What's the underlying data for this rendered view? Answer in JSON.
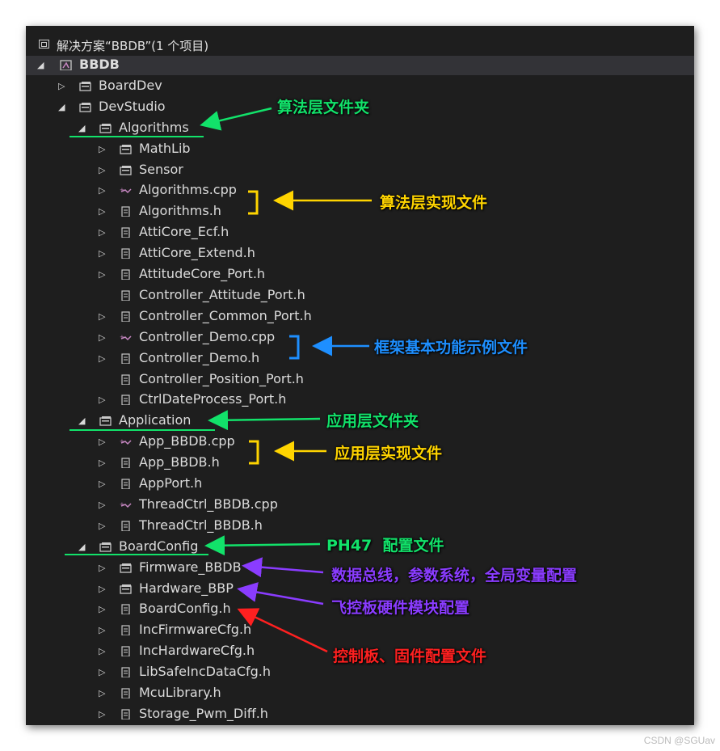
{
  "solution_header": "解决方案“BBDB”(1 个项目)",
  "tree": [
    {
      "id": "bbdb",
      "label": "BBDB",
      "depth": 0,
      "toggle": "expanded",
      "icon": "project-icon",
      "bold": true,
      "selected": true
    },
    {
      "id": "boarddev",
      "label": "BoardDev",
      "depth": 1,
      "toggle": "collapsed",
      "icon": "filter-folder-icon"
    },
    {
      "id": "devstudio",
      "label": "DevStudio",
      "depth": 1,
      "toggle": "expanded",
      "icon": "filter-folder-icon"
    },
    {
      "id": "algorithms",
      "label": "Algorithms",
      "depth": 2,
      "toggle": "expanded",
      "icon": "filter-folder-icon"
    },
    {
      "id": "mathlib",
      "label": "MathLib",
      "depth": 3,
      "toggle": "collapsed",
      "icon": "filter-folder-icon"
    },
    {
      "id": "sensor",
      "label": "Sensor",
      "depth": 3,
      "toggle": "collapsed",
      "icon": "filter-folder-icon"
    },
    {
      "id": "algorithms-cpp",
      "label": "Algorithms.cpp",
      "depth": 3,
      "toggle": "collapsed",
      "icon": "cpp-file-icon"
    },
    {
      "id": "algorithms-h",
      "label": "Algorithms.h",
      "depth": 3,
      "toggle": "collapsed",
      "icon": "header-file-icon"
    },
    {
      "id": "atticore-ecf",
      "label": "AttiCore_Ecf.h",
      "depth": 3,
      "toggle": "collapsed",
      "icon": "header-file-icon"
    },
    {
      "id": "atticore-extend",
      "label": "AttiCore_Extend.h",
      "depth": 3,
      "toggle": "collapsed",
      "icon": "header-file-icon"
    },
    {
      "id": "attitudecore-port",
      "label": "AttitudeCore_Port.h",
      "depth": 3,
      "toggle": "collapsed",
      "icon": "header-file-icon"
    },
    {
      "id": "controller-attitude-port",
      "label": "Controller_Attitude_Port.h",
      "depth": 3,
      "toggle": "none",
      "icon": "header-file-icon"
    },
    {
      "id": "controller-common-port",
      "label": "Controller_Common_Port.h",
      "depth": 3,
      "toggle": "collapsed",
      "icon": "header-file-icon"
    },
    {
      "id": "controller-demo-cpp",
      "label": "Controller_Demo.cpp",
      "depth": 3,
      "toggle": "collapsed",
      "icon": "cpp-file-icon"
    },
    {
      "id": "controller-demo-h",
      "label": "Controller_Demo.h",
      "depth": 3,
      "toggle": "collapsed",
      "icon": "header-file-icon"
    },
    {
      "id": "controller-position-port",
      "label": "Controller_Position_Port.h",
      "depth": 3,
      "toggle": "none",
      "icon": "header-file-icon"
    },
    {
      "id": "ctrldateprocess-port",
      "label": "CtrlDateProcess_Port.h",
      "depth": 3,
      "toggle": "collapsed",
      "icon": "header-file-icon"
    },
    {
      "id": "application",
      "label": "Application",
      "depth": 2,
      "toggle": "expanded",
      "icon": "filter-folder-icon"
    },
    {
      "id": "app-bbdb-cpp",
      "label": "App_BBDB.cpp",
      "depth": 3,
      "toggle": "collapsed",
      "icon": "cpp-file-icon"
    },
    {
      "id": "app-bbdb-h",
      "label": "App_BBDB.h",
      "depth": 3,
      "toggle": "collapsed",
      "icon": "header-file-icon"
    },
    {
      "id": "appport-h",
      "label": "AppPort.h",
      "depth": 3,
      "toggle": "collapsed",
      "icon": "header-file-icon"
    },
    {
      "id": "threadctrl-bbdb-cpp",
      "label": "ThreadCtrl_BBDB.cpp",
      "depth": 3,
      "toggle": "collapsed",
      "icon": "cpp-file-icon"
    },
    {
      "id": "threadctrl-bbdb-h",
      "label": "ThreadCtrl_BBDB.h",
      "depth": 3,
      "toggle": "collapsed",
      "icon": "header-file-icon"
    },
    {
      "id": "boardconfig",
      "label": "BoardConfig",
      "depth": 2,
      "toggle": "expanded",
      "icon": "filter-folder-icon"
    },
    {
      "id": "firmware-bbdb",
      "label": "Firmware_BBDB",
      "depth": 3,
      "toggle": "collapsed",
      "icon": "filter-folder-icon"
    },
    {
      "id": "hardware-bbp",
      "label": "Hardware_BBP",
      "depth": 3,
      "toggle": "collapsed",
      "icon": "filter-folder-icon"
    },
    {
      "id": "boardconfig-h",
      "label": "BoardConfig.h",
      "depth": 3,
      "toggle": "collapsed",
      "icon": "header-file-icon"
    },
    {
      "id": "incfirmwarecfg-h",
      "label": "IncFirmwareCfg.h",
      "depth": 3,
      "toggle": "collapsed",
      "icon": "header-file-icon"
    },
    {
      "id": "inchardwarecfg-h",
      "label": "IncHardwareCfg.h",
      "depth": 3,
      "toggle": "collapsed",
      "icon": "header-file-icon"
    },
    {
      "id": "libsafeincdatacfg-h",
      "label": "LibSafeIncDataCfg.h",
      "depth": 3,
      "toggle": "collapsed",
      "icon": "header-file-icon"
    },
    {
      "id": "mculibrary-h",
      "label": "McuLibrary.h",
      "depth": 3,
      "toggle": "collapsed",
      "icon": "header-file-icon"
    },
    {
      "id": "storage-pwm-diff-h",
      "label": "Storage_Pwm_Diff.h",
      "depth": 3,
      "toggle": "collapsed",
      "icon": "header-file-icon"
    }
  ],
  "annotations": {
    "algorithms_folder": "算法层文件夹",
    "algorithms_impl": "算法层实现文件",
    "framework_demo": "框架基本功能示例文件",
    "application_folder": "应用层文件夹",
    "application_impl": "应用层实现文件",
    "ph47_config": "PH47  配置文件",
    "firmware_desc": "数据总线，参数系统，全局变量配置",
    "hardware_desc": "飞控板硬件模块配置",
    "boardconfig_desc": "控制板、固件配置文件"
  },
  "colors": {
    "green": "#12e26a",
    "yellow": "#ffd400",
    "blue": "#1e8fff",
    "purple": "#8a3cff",
    "red": "#ff2020",
    "panel_bg": "#1e1e1e"
  },
  "watermark": "CSDN @SGUav"
}
